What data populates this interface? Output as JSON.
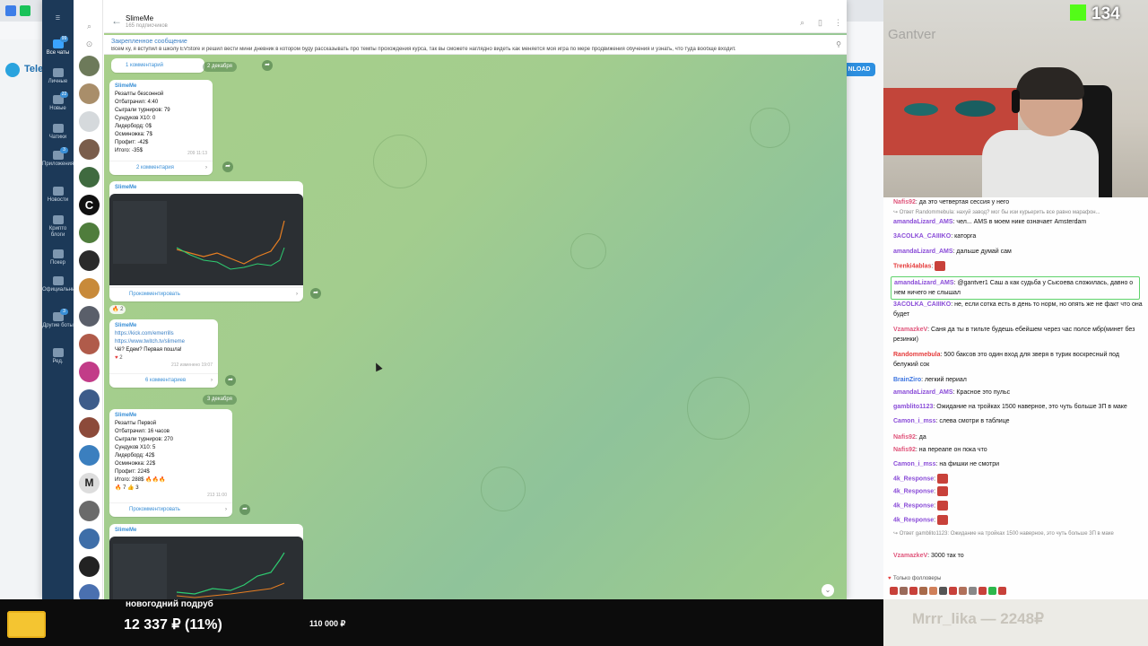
{
  "browser": {
    "partial_brand": "Tele",
    "download_label": "NLOAD"
  },
  "telegram": {
    "folders": [
      {
        "label": "Все чаты",
        "badge": "99"
      },
      {
        "label": "Личные",
        "badge": ""
      },
      {
        "label": "Новые",
        "badge": "22"
      },
      {
        "label": "Чатики",
        "badge": ""
      },
      {
        "label": "Приложения",
        "badge": "3"
      },
      {
        "label": "Новости",
        "badge": ""
      },
      {
        "label": "Крипто блоги",
        "badge": ""
      },
      {
        "label": "Покер",
        "badge": ""
      },
      {
        "label": "Официальные",
        "badge": ""
      },
      {
        "label": "Другие боты",
        "badge": "3"
      },
      {
        "label": "Ред.",
        "badge": ""
      }
    ],
    "channel": {
      "title": "SlimeMe",
      "subscribers": "165 подписчиков"
    },
    "pinned": {
      "title": "Закрепленное сообщение",
      "text": "Всем ку, я вступил в школу EVStore и решил вести мини дневник в котором буду рассказывать про темпы прохождения курса, так вы сможете наглядно видеть как меняется моя игра по мере продвижения обучения и узнать, что туда вообще входит."
    },
    "messages": {
      "m0": {
        "comments": "1 комментарий",
        "date": "2 декабря"
      },
      "m1": {
        "author": "SlimeMe",
        "lines": [
          "Резалты безсонной",
          "Отбатрачил: 4:40",
          "Сыграли турниров: 79",
          "Сундуков X10: 0",
          "Лидерборд: 0$",
          "Осминожка: 7$",
          "Профит: -42$",
          "Итого: -35$"
        ],
        "meta": "209  11:13",
        "comments": "2 комментария"
      },
      "m2": {
        "author": "SlimeMe",
        "comment": "Прокомментировать",
        "reaction": "2"
      },
      "m3": {
        "author": "SlimeMe",
        "link1": "https://kick.com/emerrills",
        "link2": "https://www.twitch.tv/slimeme",
        "lines": [
          "Чё? Едем? Первая пошла!"
        ],
        "reaction": "2",
        "meta": "212  изменено 19:07",
        "comments": "6 комментариев",
        "date": "3 декабря"
      },
      "m4": {
        "author": "SlimeMe",
        "lines": [
          "Резалты Первой",
          "Отбатрачил: 16 часов",
          "Сыграли турниров: 270",
          "Сундуков X10: 5",
          "Лидерборд: 42$",
          "Осминожка: 22$",
          "Профит: 224$",
          "Итого: 288$ 🔥🔥🔥"
        ],
        "reactions": "🔥 7   👍 3",
        "meta": "213  11:00",
        "comment": "Прокомментировать"
      },
      "m5": {
        "author": "SlimeMe"
      }
    }
  },
  "stream": {
    "viewers": "134",
    "cam_text": "Gantver",
    "chat": [
      {
        "reply": "",
        "user": "Nafis92",
        "color": "#e0557b",
        "text": "да это четвертая сессия у него"
      },
      {
        "reply": "↪ Ответ Randommebula: нахуй завод? мог бы изи курьерить все равно марафон...",
        "user": "",
        "color": "",
        "text": ""
      },
      {
        "user": "amandaLizard_AMS",
        "color": "#8a4cd8",
        "text": "чел... AMS в моем нике означает Amsterdam"
      },
      {
        "user": "3ACOLKA_CAIIIKO",
        "color": "#8a4cd8",
        "text": "каторга"
      },
      {
        "user": "amandaLizard_AMS",
        "color": "#8a4cd8",
        "text": "дальше думай сам"
      },
      {
        "user": "Trenki4ablas",
        "color": "#e53b3b",
        "text": ""
      },
      {
        "user": "amandaLizard_AMS",
        "color": "#8a4cd8",
        "text": "@gantver1 Саш а как судьба у Сысоева сложилась, давно о нем ничего не слышал"
      },
      {
        "user": "3ACOLKA_CAIIIKO",
        "color": "#8a4cd8",
        "text": "не, если сотка есть в день то норм, но опять же не факт что она будет"
      },
      {
        "user": "VzamazkeV",
        "color": "#e0557b",
        "text": "Саня да ты в тильте будешь ебейшем через час полсе мбр(минет без резинки)"
      },
      {
        "user": "Randommebula",
        "color": "#e53b3b",
        "text": "500 баксов это один вход для зверя в турик воскресный под белужий сок"
      },
      {
        "user": "BrainZiro",
        "color": "#3a73e0",
        "text": "легкий периал"
      },
      {
        "user": "amandaLizard_AMS",
        "color": "#8a4cd8",
        "text": "Красное это пульс"
      },
      {
        "user": "gamblito1123",
        "color": "#8a4cd8",
        "text": "Ожидание на тройках 1500 наверное, это чуть больше 3П в маке"
      },
      {
        "user": "Camon_i_mss",
        "color": "#8a4cd8",
        "text": "слева смотри в таблице"
      },
      {
        "user": "Nafis92",
        "color": "#e0557b",
        "text": "да"
      },
      {
        "user": "Nafis92",
        "color": "#e0557b",
        "text": "на переапе он пока что"
      },
      {
        "user": "Camon_i_mss",
        "color": "#8a4cd8",
        "text": "на фишки не смотри"
      },
      {
        "user": "4k_Response",
        "color": "#8a4cd8",
        "text": ""
      },
      {
        "user": "4k_Response",
        "color": "#8a4cd8",
        "text": ""
      },
      {
        "user": "4k_Response",
        "color": "#8a4cd8",
        "text": ""
      },
      {
        "user": "4k_Response",
        "color": "#8a4cd8",
        "text": ""
      },
      {
        "reply": "↪ Ответ gamblito1123: Ожидание на тройках 1500 наверное, это чуть больше 3П в маке",
        "user": "",
        "color": "",
        "text": ""
      },
      {
        "user": "VzamazkeV",
        "color": "#e0557b",
        "text": "3000 так то"
      }
    ],
    "followers_only": "Только фолловеры",
    "goal": {
      "title": "новогодний подруб",
      "amount": "12 337 ₽ (11%)",
      "target": "110 000 ₽",
      "progress": 0.11
    },
    "donor": "Mrrr_lika — 2248₽"
  }
}
